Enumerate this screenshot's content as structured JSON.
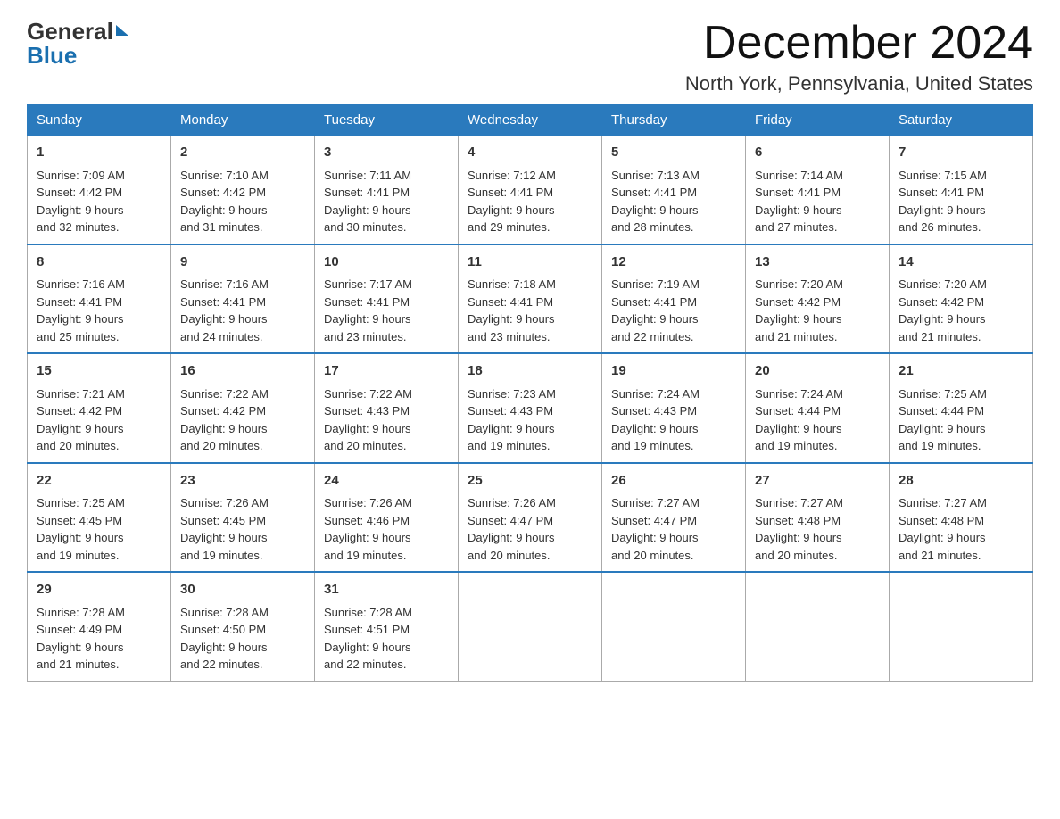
{
  "header": {
    "logo_general": "General",
    "logo_blue": "Blue",
    "month_year": "December 2024",
    "location": "North York, Pennsylvania, United States"
  },
  "days_of_week": [
    "Sunday",
    "Monday",
    "Tuesday",
    "Wednesday",
    "Thursday",
    "Friday",
    "Saturday"
  ],
  "weeks": [
    [
      {
        "day": "1",
        "sunrise": "7:09 AM",
        "sunset": "4:42 PM",
        "daylight": "9 hours and 32 minutes."
      },
      {
        "day": "2",
        "sunrise": "7:10 AM",
        "sunset": "4:42 PM",
        "daylight": "9 hours and 31 minutes."
      },
      {
        "day": "3",
        "sunrise": "7:11 AM",
        "sunset": "4:41 PM",
        "daylight": "9 hours and 30 minutes."
      },
      {
        "day": "4",
        "sunrise": "7:12 AM",
        "sunset": "4:41 PM",
        "daylight": "9 hours and 29 minutes."
      },
      {
        "day": "5",
        "sunrise": "7:13 AM",
        "sunset": "4:41 PM",
        "daylight": "9 hours and 28 minutes."
      },
      {
        "day": "6",
        "sunrise": "7:14 AM",
        "sunset": "4:41 PM",
        "daylight": "9 hours and 27 minutes."
      },
      {
        "day": "7",
        "sunrise": "7:15 AM",
        "sunset": "4:41 PM",
        "daylight": "9 hours and 26 minutes."
      }
    ],
    [
      {
        "day": "8",
        "sunrise": "7:16 AM",
        "sunset": "4:41 PM",
        "daylight": "9 hours and 25 minutes."
      },
      {
        "day": "9",
        "sunrise": "7:16 AM",
        "sunset": "4:41 PM",
        "daylight": "9 hours and 24 minutes."
      },
      {
        "day": "10",
        "sunrise": "7:17 AM",
        "sunset": "4:41 PM",
        "daylight": "9 hours and 23 minutes."
      },
      {
        "day": "11",
        "sunrise": "7:18 AM",
        "sunset": "4:41 PM",
        "daylight": "9 hours and 23 minutes."
      },
      {
        "day": "12",
        "sunrise": "7:19 AM",
        "sunset": "4:41 PM",
        "daylight": "9 hours and 22 minutes."
      },
      {
        "day": "13",
        "sunrise": "7:20 AM",
        "sunset": "4:42 PM",
        "daylight": "9 hours and 21 minutes."
      },
      {
        "day": "14",
        "sunrise": "7:20 AM",
        "sunset": "4:42 PM",
        "daylight": "9 hours and 21 minutes."
      }
    ],
    [
      {
        "day": "15",
        "sunrise": "7:21 AM",
        "sunset": "4:42 PM",
        "daylight": "9 hours and 20 minutes."
      },
      {
        "day": "16",
        "sunrise": "7:22 AM",
        "sunset": "4:42 PM",
        "daylight": "9 hours and 20 minutes."
      },
      {
        "day": "17",
        "sunrise": "7:22 AM",
        "sunset": "4:43 PM",
        "daylight": "9 hours and 20 minutes."
      },
      {
        "day": "18",
        "sunrise": "7:23 AM",
        "sunset": "4:43 PM",
        "daylight": "9 hours and 19 minutes."
      },
      {
        "day": "19",
        "sunrise": "7:24 AM",
        "sunset": "4:43 PM",
        "daylight": "9 hours and 19 minutes."
      },
      {
        "day": "20",
        "sunrise": "7:24 AM",
        "sunset": "4:44 PM",
        "daylight": "9 hours and 19 minutes."
      },
      {
        "day": "21",
        "sunrise": "7:25 AM",
        "sunset": "4:44 PM",
        "daylight": "9 hours and 19 minutes."
      }
    ],
    [
      {
        "day": "22",
        "sunrise": "7:25 AM",
        "sunset": "4:45 PM",
        "daylight": "9 hours and 19 minutes."
      },
      {
        "day": "23",
        "sunrise": "7:26 AM",
        "sunset": "4:45 PM",
        "daylight": "9 hours and 19 minutes."
      },
      {
        "day": "24",
        "sunrise": "7:26 AM",
        "sunset": "4:46 PM",
        "daylight": "9 hours and 19 minutes."
      },
      {
        "day": "25",
        "sunrise": "7:26 AM",
        "sunset": "4:47 PM",
        "daylight": "9 hours and 20 minutes."
      },
      {
        "day": "26",
        "sunrise": "7:27 AM",
        "sunset": "4:47 PM",
        "daylight": "9 hours and 20 minutes."
      },
      {
        "day": "27",
        "sunrise": "7:27 AM",
        "sunset": "4:48 PM",
        "daylight": "9 hours and 20 minutes."
      },
      {
        "day": "28",
        "sunrise": "7:27 AM",
        "sunset": "4:48 PM",
        "daylight": "9 hours and 21 minutes."
      }
    ],
    [
      {
        "day": "29",
        "sunrise": "7:28 AM",
        "sunset": "4:49 PM",
        "daylight": "9 hours and 21 minutes."
      },
      {
        "day": "30",
        "sunrise": "7:28 AM",
        "sunset": "4:50 PM",
        "daylight": "9 hours and 22 minutes."
      },
      {
        "day": "31",
        "sunrise": "7:28 AM",
        "sunset": "4:51 PM",
        "daylight": "9 hours and 22 minutes."
      },
      null,
      null,
      null,
      null
    ]
  ],
  "labels": {
    "sunrise": "Sunrise:",
    "sunset": "Sunset:",
    "daylight": "Daylight:"
  }
}
